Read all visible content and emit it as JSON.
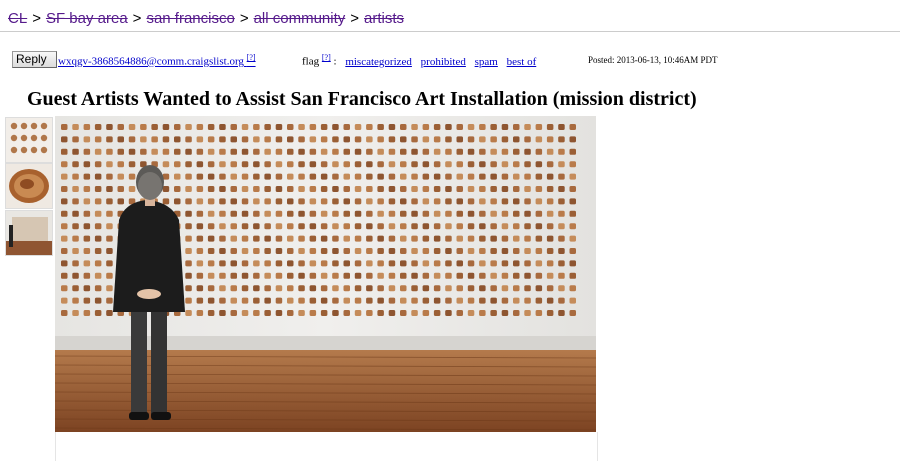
{
  "breadcrumb": {
    "items": [
      "CL",
      "SF bay area",
      "san francisco",
      "all community",
      "artists"
    ],
    "separator": ">"
  },
  "reply_bar": {
    "reply_label": "Reply",
    "email": "wxqgv-3868564886@comm.craigslist.org",
    "email_note": "[?]",
    "flag_label": "flag",
    "flag_note": "[?]",
    "flag_colon": ":",
    "flag_options": [
      "miscategorized",
      "prohibited",
      "spam",
      "best of"
    ],
    "posted": "Posted: 2013-06-13, 10:46AM PDT"
  },
  "posting": {
    "title": "Guest Artists Wanted to Assist San Francisco Art Installation (mission district)"
  },
  "colors": {
    "visited_link": "#551a8b",
    "link": "#0000cc",
    "wall": "#ebebe9",
    "floor": "#9a5a33"
  }
}
